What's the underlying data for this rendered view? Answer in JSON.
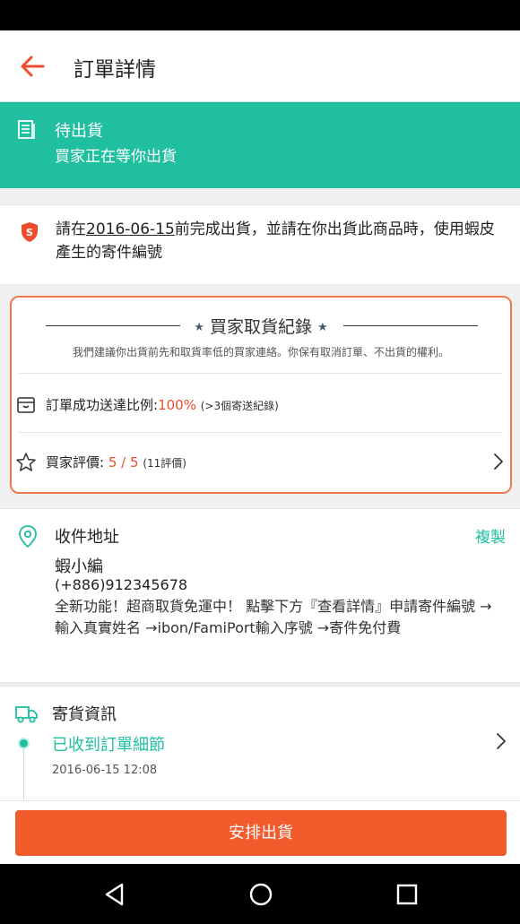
{
  "header": {
    "title": "訂單詳情"
  },
  "status_banner": {
    "title": "待出貨",
    "subtitle": "買家正在等你出貨"
  },
  "notice": {
    "text_before": "請在",
    "date": "2016-06-15",
    "text_after": "前完成出貨，並請在你出貨此商品時，使用蝦皮產生的寄件編號"
  },
  "buyer_record": {
    "title": "買家取貨紀錄",
    "subtitle": "我們建議你出貨前先和取貨率低的買家連絡。你保有取消訂單、不出貨的權利。",
    "success_rate_label": "訂單成功送達比例:",
    "success_rate_value": "100%",
    "success_rate_note": "(>3個寄送紀錄)",
    "rating_label": "買家評價:",
    "rating_value": "5 / 5",
    "rating_note": "(11評價)"
  },
  "address": {
    "title": "收件地址",
    "copy_label": "複製",
    "name": "蝦小編",
    "phone": "(+886)912345678",
    "note": "全新功能！超商取貨免運中！ 點擊下方『查看詳情』申請寄件編號 →輸入真實姓名 →ibon/FamiPort輸入序號 →寄件免付費"
  },
  "shipping": {
    "title": "寄貨資訊",
    "status": "已收到訂單細節",
    "timestamp": "2016-06-15 12:08"
  },
  "action": {
    "arrange_label": "安排出貨"
  },
  "colors": {
    "brand_orange": "#ee4d2d",
    "teal": "#1fbf9f"
  }
}
